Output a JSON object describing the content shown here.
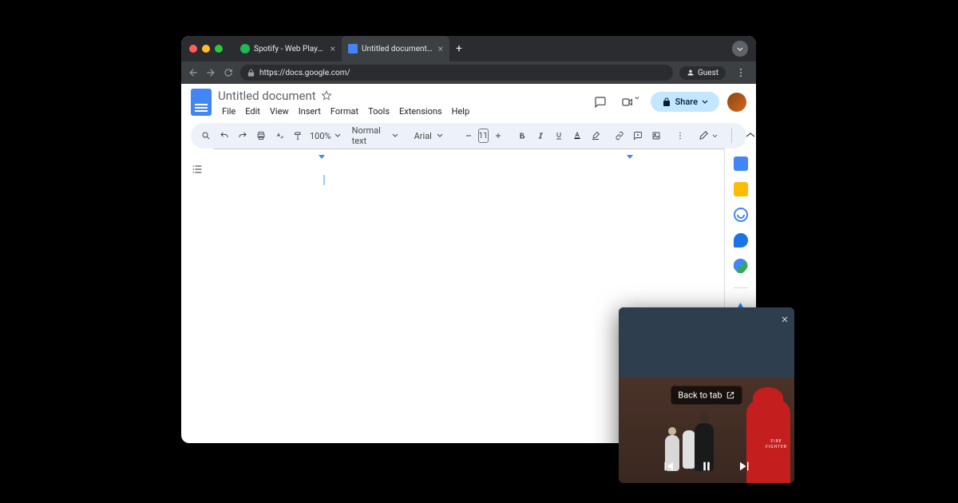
{
  "browser": {
    "tabs": [
      {
        "title": "Spotify - Web Player: Music f",
        "icon": "spotify"
      },
      {
        "title": "Untitled document - Google D",
        "icon": "gdocs",
        "active": true
      }
    ],
    "url": "https://docs.google.com/",
    "guest_label": "Guest"
  },
  "docs": {
    "title": "Untitled document",
    "menus": [
      "File",
      "Edit",
      "View",
      "Insert",
      "Format",
      "Tools",
      "Extensions",
      "Help"
    ],
    "share_label": "Share",
    "toolbar": {
      "zoom": "100%",
      "style": "Normal text",
      "font": "Arial",
      "font_size": "11"
    }
  },
  "pip": {
    "back_label": "Back to tab",
    "jacket_text_1": "FIRE",
    "jacket_text_2": "FIGHTER"
  }
}
